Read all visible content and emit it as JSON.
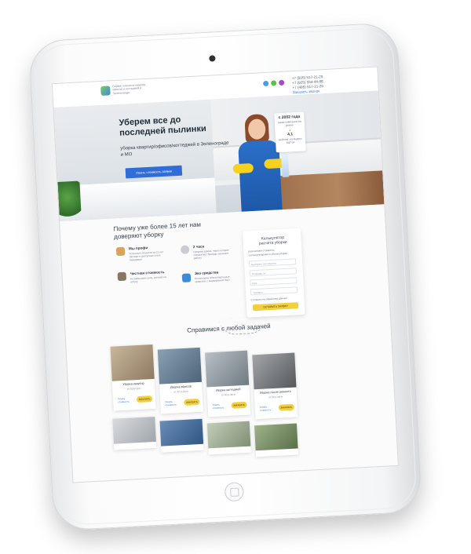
{
  "header": {
    "logo_text": "Сервис клининга квартир, офисов и коттеджей в Зеленограде",
    "phones": [
      "+7 (925) 517-21-20",
      "+7 (925) 344-44-88",
      "+7 (495) 517-21-20"
    ],
    "callback": "Заказать звонок",
    "social_colors": [
      "#4c9be8",
      "#5fbf4f",
      "#a64ac9"
    ]
  },
  "hero": {
    "title": "Уберем все до последней пылинки",
    "subtitle": "уборка квартир/офисов/коттеджей в Зеленограде и МО",
    "cta": "Узнать стоимость заявки",
    "badge_year": "с 2002 года",
    "badge_year_note": "наша компания на рынке",
    "badge_rating": "4,1",
    "badge_rating_note": "рейтинг на яндекс картах"
  },
  "why": {
    "title": "Почему уже более 15 лет нам доверяют уборку",
    "features": [
      {
        "title": "Мы профи",
        "desc": "Успешных объектов за 15 лет Экспорт и доступные а все передовые"
      },
      {
        "title": "2 часа",
        "desc": "Среднее время, через которое специалист бригады начинает работу"
      },
      {
        "title": "Честная стоимость",
        "desc": "Не завышаем цену, договор на услугу"
      },
      {
        "title": "Эко средства",
        "desc": "Используем гипоаллергенные средства, с маркировкой ЭКО"
      }
    ]
  },
  "calculator": {
    "title": "Калькулятор расчета уборки",
    "options": [
      "рассчитаем стоимость",
      "согласуем время и объем уборки"
    ],
    "fields": [
      "Выберите тип объекта",
      "Площадь, м²",
      "Имя",
      "Телефон"
    ],
    "consent": "Согласен на обработку данных",
    "submit": "ОСТАВИТЬ ЗАЯВКУ"
  },
  "services": {
    "title": "Справимся с любой задачей",
    "cards": [
      {
        "name": "Уборка квартир",
        "price": "от 2000 руб",
        "link": "Узнать стоимость",
        "order": "ЗАКАЗАТЬ"
      },
      {
        "name": "Уборка офисов",
        "price": "от 40 р./кв.м",
        "link": "Узнать стоимость",
        "order": "ЗАКАЗАТЬ"
      },
      {
        "name": "Уборка коттеджей",
        "price": "от 40 р./кв.м",
        "link": "Узнать стоимость",
        "order": "ЗАКАЗАТЬ"
      },
      {
        "name": "Уборка после ремонта",
        "price": "от 80 р./кв.м",
        "link": "Узнать стоимость",
        "order": "ЗАКАЗАТЬ"
      }
    ]
  },
  "colors": {
    "accent_blue": "#2f6ed8",
    "accent_yellow": "#f4cf3d"
  }
}
